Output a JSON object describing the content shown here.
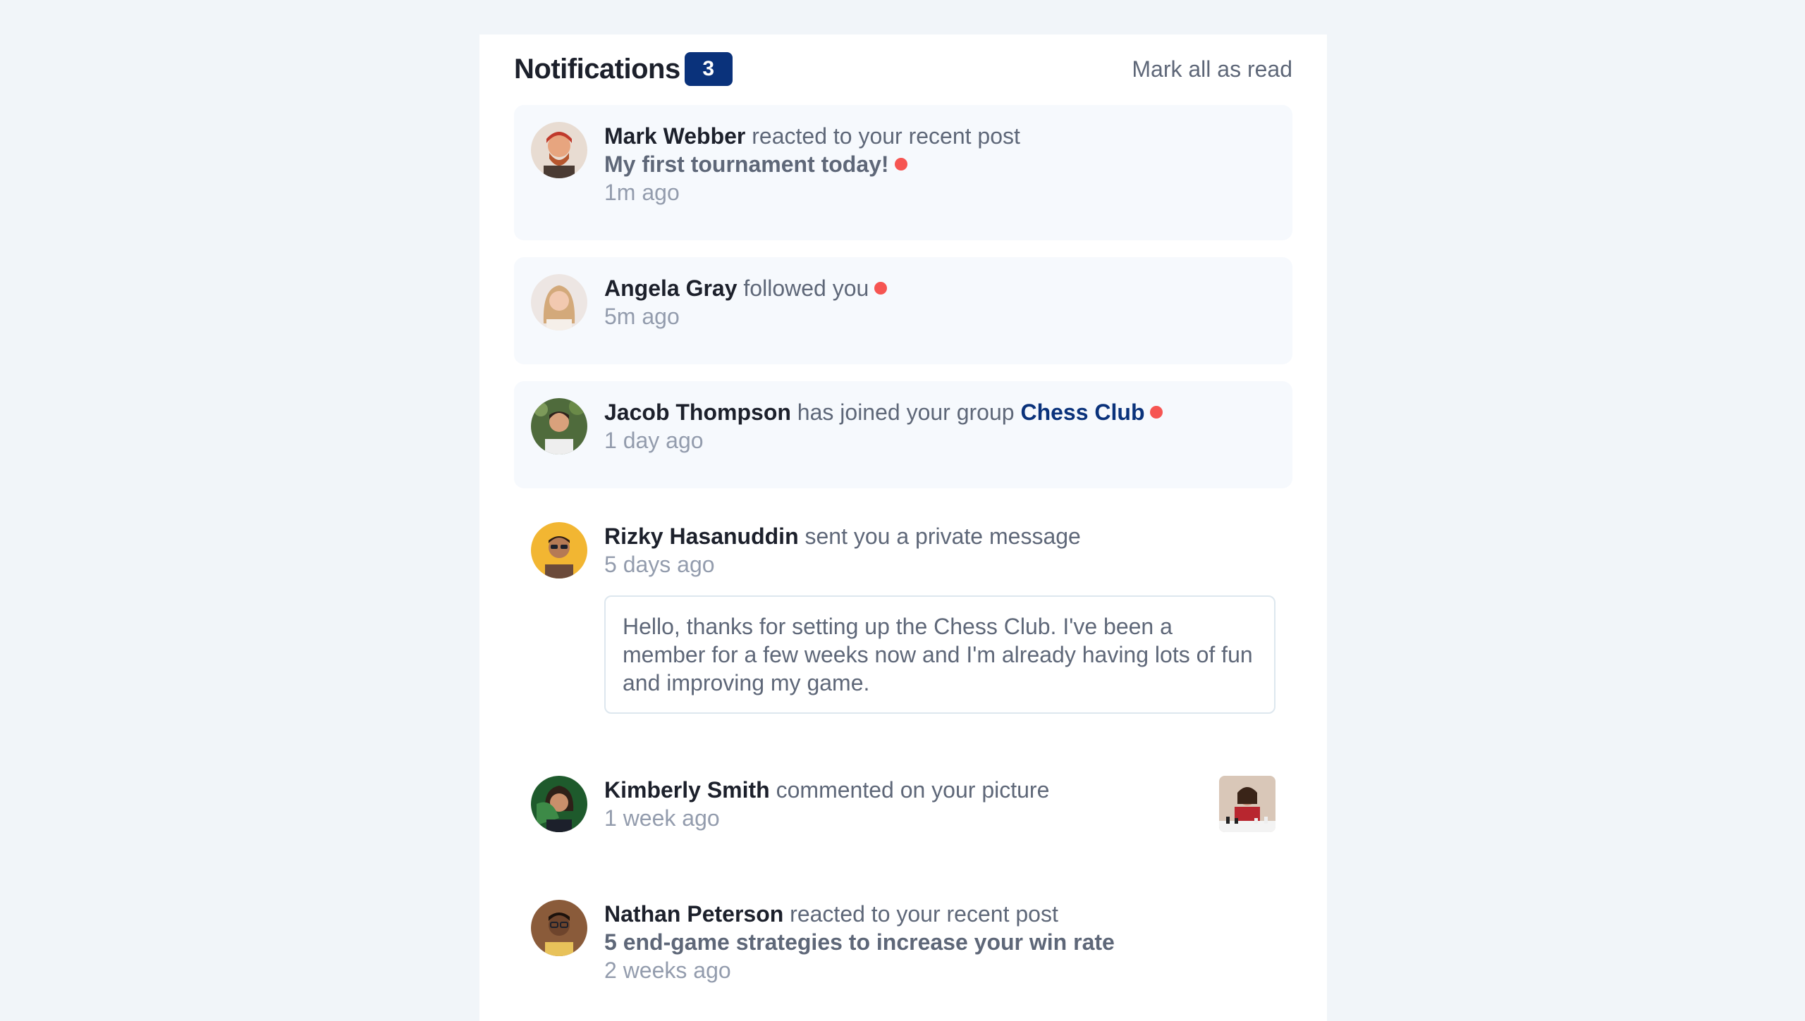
{
  "header": {
    "title": "Notifications",
    "unread_count": "3",
    "mark_all_label": "Mark all as read"
  },
  "notifications": [
    {
      "name": "Mark Webber",
      "action": "reacted to your recent post",
      "post": "My first tournament today!",
      "time": "1m ago",
      "unread": true
    },
    {
      "name": "Angela Gray",
      "action": "followed you",
      "time": "5m ago",
      "unread": true
    },
    {
      "name": "Jacob Thompson",
      "action": "has joined your group",
      "group": "Chess Club",
      "time": "1 day ago",
      "unread": true
    },
    {
      "name": "Rizky Hasanuddin",
      "action": "sent you a private message",
      "time": "5 days ago",
      "message": "Hello, thanks for setting up the Chess Club. I've been a member for a few weeks now and I'm already having lots of fun and improving my game.",
      "unread": false
    },
    {
      "name": "Kimberly Smith",
      "action": "commented on your picture",
      "time": "1 week ago",
      "unread": false
    },
    {
      "name": "Nathan Peterson",
      "action": "reacted to your recent post",
      "post": "5 end-game strategies to increase your win rate",
      "time": "2 weeks ago",
      "unread": false
    }
  ],
  "colors": {
    "unread_bg": "#f6f9fd",
    "badge": "#0a327b",
    "dot": "#f65552",
    "heading": "#1c202b",
    "text": "#5e6778",
    "muted": "#939cad"
  },
  "icons": {
    "unread_marker": "red-dot-icon",
    "picture": "chess-picture-thumbnail"
  }
}
